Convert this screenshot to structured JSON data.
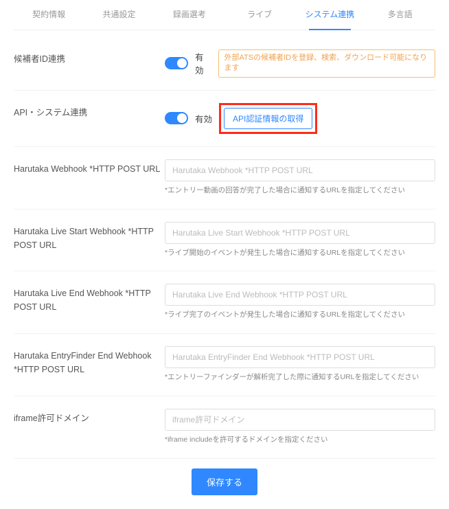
{
  "tabs": [
    "契約情報",
    "共通設定",
    "録画選考",
    "ライブ",
    "システム連携",
    "多言語"
  ],
  "active_tab_index": 4,
  "rows": {
    "candidate_id": {
      "label": "候補者ID連携",
      "toggle_label": "有効",
      "note": "外部ATSの候補者IDを登録、検索、ダウンロード可能になります"
    },
    "api_system": {
      "label": "API・システム連携",
      "toggle_label": "有効",
      "button": "API認証情報の取得"
    },
    "webhook": {
      "label": "Harutaka Webhook *HTTP POST URL",
      "placeholder": "Harutaka Webhook *HTTP POST URL",
      "hint": "*エントリー動画の回答が完了した場合に通知するURLを指定してください"
    },
    "live_start": {
      "label": "Harutaka Live Start Webhook *HTTP POST URL",
      "placeholder": "Harutaka Live Start Webhook *HTTP POST URL",
      "hint": "*ライブ開始のイベントが発生した場合に通知するURLを指定してください"
    },
    "live_end": {
      "label": "Harutaka Live End Webhook *HTTP POST URL",
      "placeholder": "Harutaka Live End Webhook *HTTP POST URL",
      "hint": "*ライブ完了のイベントが発生した場合に通知するURLを指定してください"
    },
    "entryfinder": {
      "label": "Harutaka EntryFinder End Webhook *HTTP POST URL",
      "placeholder": "Harutaka EntryFinder End Webhook *HTTP POST URL",
      "hint": "*エントリーファインダーが解析完了した際に通知するURLを指定してください"
    },
    "iframe": {
      "label": "iframe許可ドメイン",
      "placeholder": "iframe許可ドメイン",
      "hint": "*iframe includeを許可するドメインを指定ください"
    }
  },
  "save_button": "保存する"
}
